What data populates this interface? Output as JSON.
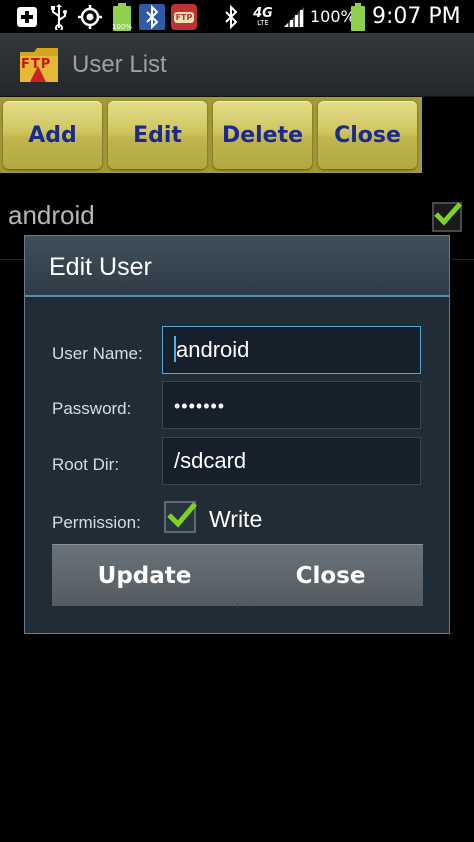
{
  "status_bar": {
    "battery_small_label": "100%",
    "ftp_badge": "FTP",
    "network_label": "4G",
    "network_sublabel": "LTE",
    "battery_percent": "100%",
    "time": "9:07 PM",
    "icons": [
      "plus-box-icon",
      "usb-icon",
      "gps-icon",
      "battery-icon",
      "bluetooth-icon",
      "ftp-notification-icon",
      "bluetooth-icon",
      "4g-lte-icon",
      "signal-icon",
      "battery-icon"
    ]
  },
  "app": {
    "title": "User List",
    "icon_text": "FTP"
  },
  "toolbar": {
    "add_label": "Add",
    "edit_label": "Edit",
    "delete_label": "Delete",
    "close_label": "Close"
  },
  "user_list": [
    {
      "name": "android",
      "checked": true
    }
  ],
  "dialog": {
    "title": "Edit User",
    "fields": {
      "username_label": "User Name:",
      "username_value": "android",
      "password_label": "Password:",
      "password_value": "•••••••",
      "rootdir_label": "Root Dir:",
      "rootdir_value": "/sdcard"
    },
    "permission_label": "Permission:",
    "write_label": "Write",
    "write_checked": true,
    "update_label": "Update",
    "close_label": "Close"
  },
  "colors": {
    "toolbar_button": "#cfc661",
    "toolbar_text": "#1b2a8c",
    "dialog_accent": "#4f8fb3",
    "checkmark": "#7ed321"
  }
}
